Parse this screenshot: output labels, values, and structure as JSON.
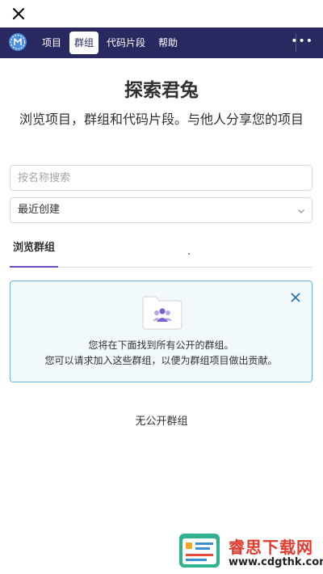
{
  "topbar": {
    "close_icon": "close-icon"
  },
  "navbar": {
    "logo_icon": "gitee-logo-icon",
    "items": [
      {
        "label": "项目",
        "active": false
      },
      {
        "label": "群组",
        "active": true
      },
      {
        "label": "代码片段",
        "active": false
      },
      {
        "label": "帮助",
        "active": false
      }
    ],
    "more_label": "•••",
    "background": "#292961"
  },
  "main": {
    "title": "探索君兔",
    "subtitle": "浏览项目，群组和代码片段。与他人分享您的项目",
    "search": {
      "placeholder": "按名称搜索",
      "value": ""
    },
    "sort": {
      "selected": "最近创建"
    },
    "tabs": [
      {
        "label": "浏览群组",
        "active": true
      }
    ],
    "accent": "#6e49cb"
  },
  "alert": {
    "line1": "您将在下面找到所有公开的群组。",
    "line2": "您可以请求加入这些群组，以便为群组项目做出贡献。",
    "icon": "folder-users-icon",
    "border": "#6fb6dd"
  },
  "empty_state": {
    "text": "无公开群组"
  },
  "watermark": {
    "title": "睿思下载网",
    "url": "www.cdgthk.com"
  }
}
